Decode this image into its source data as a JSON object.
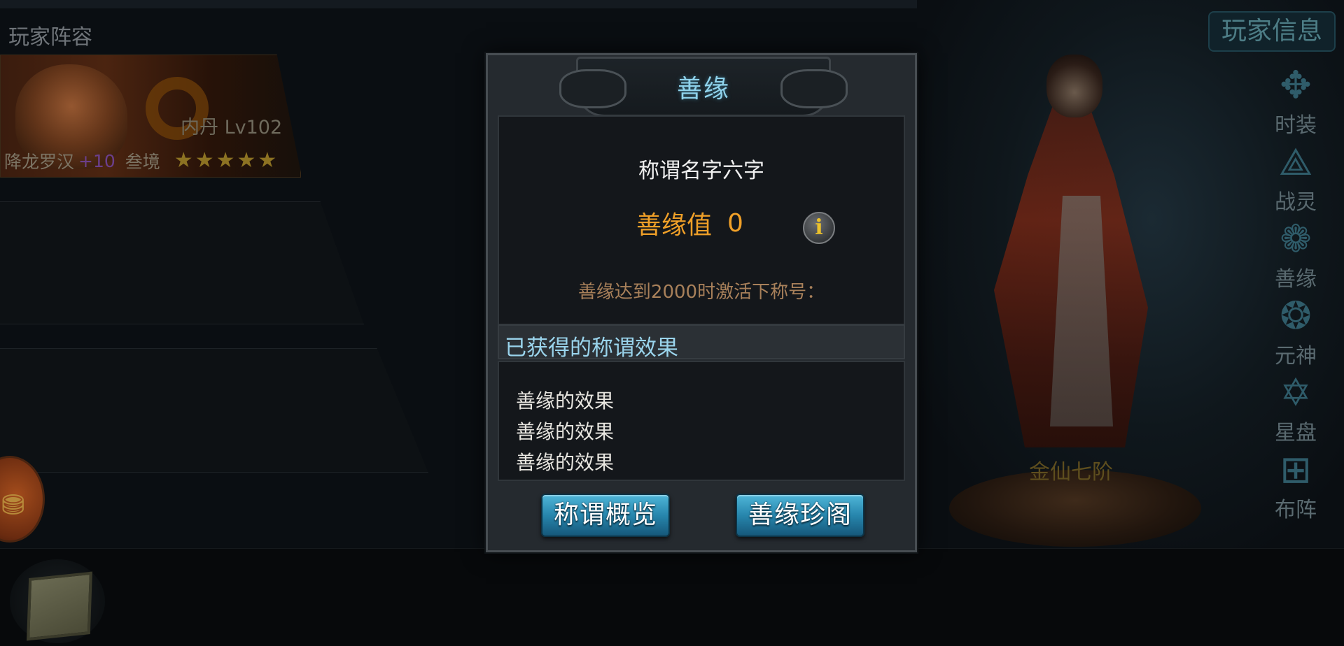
{
  "background": {
    "section_title": "玩家阵容",
    "hero": {
      "inner_core": "内丹 Lv102",
      "name": "降龙罗汉",
      "plus": "+10",
      "realm": "叁境",
      "stars": 5
    },
    "character_rank": "金仙七阶",
    "player_info_button": "玩家信息",
    "side_menu": [
      {
        "label": "时装",
        "icon": "costume-icon"
      },
      {
        "label": "战灵",
        "icon": "spirit-icon"
      },
      {
        "label": "善缘",
        "icon": "flower-icon"
      },
      {
        "label": "元神",
        "icon": "swirl-icon"
      },
      {
        "label": "星盘",
        "icon": "star-chart-icon"
      },
      {
        "label": "布阵",
        "icon": "formation-icon"
      }
    ]
  },
  "dialog": {
    "title": "善缘",
    "title_name": "称谓名字六字",
    "shanyuan_label": "善缘值",
    "shanyuan_value": "0",
    "activate_hint": "善缘达到2000时激活下称号：",
    "effects_header": "已获得的称谓效果",
    "effects": [
      "善缘的效果",
      "善缘的效果",
      "善缘的效果"
    ],
    "buttons": {
      "overview": "称谓概览",
      "treasure": "善缘珍阁"
    }
  },
  "colors": {
    "accent_blue": "#8fd3ec",
    "value_orange": "#f0a028",
    "hint_brown": "#a8805a",
    "button_blue": "#2786ad"
  }
}
